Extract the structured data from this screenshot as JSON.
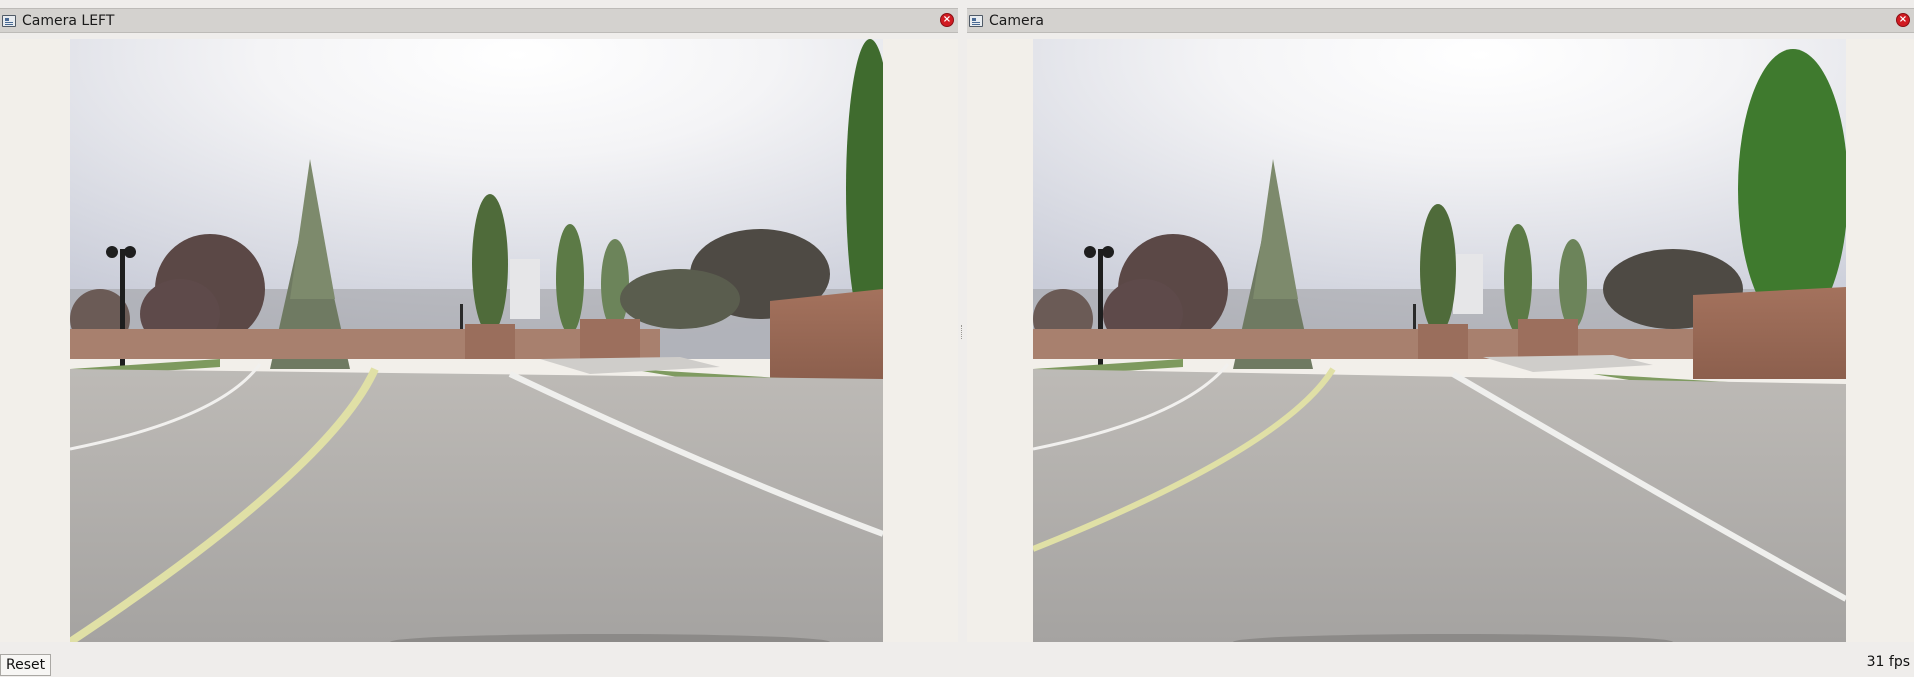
{
  "left_panel": {
    "title": "Camera LEFT",
    "icon": "camera-window-icon",
    "close_icon": "close-icon"
  },
  "right_panel": {
    "title": "Camera",
    "icon": "camera-window-icon",
    "close_icon": "close-icon"
  },
  "close_glyph": "×",
  "footer": {
    "reset_label": "Reset",
    "fps_text": "31 fps"
  },
  "colors": {
    "close": "#d11b22",
    "titlebar": "#d4d2cf",
    "background": "#efedeb"
  }
}
